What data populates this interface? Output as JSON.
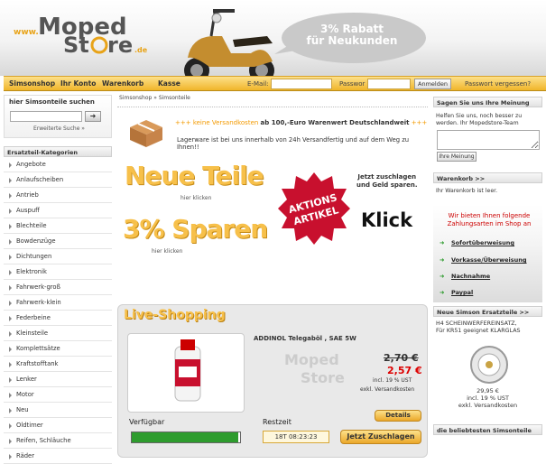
{
  "header": {
    "logo_text": "www.MopedStore.de",
    "promo_line1": "3% Rabatt",
    "promo_line2": "für Neukunden"
  },
  "nav": {
    "links": [
      "Simsonshop",
      "Ihr Konto",
      "Warenkorb",
      "Kasse"
    ],
    "email_label": "E-Mail:",
    "password_label": "Passwor",
    "login_button": "Anmelden",
    "forgot": "Passwort vergessen?"
  },
  "left": {
    "search_title": "hier Simsonteile suchen",
    "search_button": "➜",
    "advanced_search": "Erweiterte Suche »",
    "categories_title": "Ersatzteil-Kategorien",
    "categories": [
      "Angebote",
      "Anlaufscheiben",
      "Antrieb",
      "Auspuff",
      "Blechteile",
      "Bowdenzüge",
      "Dichtungen",
      "Elektronik",
      "Fahrwerk-groß",
      "Fahrwerk-klein",
      "Federbeine",
      "Kleinsteile",
      "Komplettsätze",
      "Kraftstofftank",
      "Lenker",
      "Motor",
      "Neu",
      "Oldtimer",
      "Reifen, Schläuche",
      "Räder"
    ]
  },
  "main": {
    "breadcrumb": "Simsonshop » Simsonteile",
    "shipping_a": "+++ keine Versandkosten",
    "shipping_b": "ab 100,-Euro Warenwert Deutschlandweit",
    "shipping_c": "+++",
    "dispatch": "Lagerware ist bei uns innerhalb von 24h Versandfertig und auf dem Weg zu Ihnen!!",
    "neue_teile": "Neue Teile",
    "hier_klicken": "hier klicken",
    "sparen": "3% Sparen",
    "aktion_line1": "AKTIONS",
    "aktion_line2": "ARTIKEL",
    "zuschlagen_line1": "Jetzt zuschlagen",
    "zuschlagen_line2": "und Geld sparen.",
    "klick": "Klick"
  },
  "live": {
    "title": "Live-Shopping",
    "product_name": "ADDINOL Telegaböl , SAE 5W",
    "old_price": "2,70 €",
    "new_price": "2,57 €",
    "vat": "incl. 19 % UST",
    "shipping": "exkl.  Versandkosten",
    "details_button": "Details",
    "available_label": "Verfügbar",
    "available_fraction": 0.98,
    "remaining_label": "Restzeit",
    "timer": "18T 08:23:23",
    "buy_button": "Jetzt Zuschlagen"
  },
  "right": {
    "opinion_title": "Sagen Sie uns Ihre Meinung",
    "opinion_line1": "Helfen Sie uns, noch besser zu",
    "opinion_line2": "werden. Ihr Mopedstore-Team",
    "opinion_button": "Ihre Meinung",
    "cart_title": "Warenkorb >>",
    "cart_text": "Ihr Warenkorb ist leer.",
    "pay_title_line1": "Wir bieten Ihnen folgende",
    "pay_title_line2": "Zahlungsarten im Shop an",
    "payments": [
      "Sofortüberweisung",
      "Vorkasse/Überweisung",
      "Nachnahme",
      "Paypal"
    ],
    "new_title": "Neue Simson Ersatzteile >>",
    "new_desc_line1": "H4 SCHEINWERFEREINSATZ,",
    "new_desc_line2": "Für KR51 geeignet KLARGLAS",
    "new_price": "29,95 €",
    "new_vat": "incl. 19 % UST",
    "new_shipping": "exkl.  Versandkosten",
    "best_title": "die beliebtesten Simsonteile"
  },
  "colors": {
    "accent": "#f0b52a",
    "orange_text": "#f39a00",
    "price_red": "#dd0000",
    "progress_green": "#2e9c2e"
  }
}
